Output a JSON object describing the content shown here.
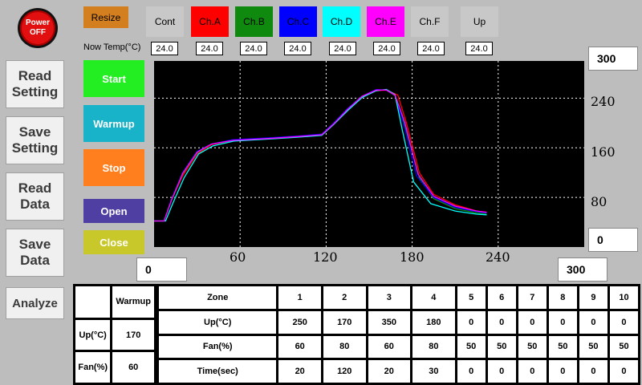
{
  "power": {
    "line1": "Power",
    "line2": "OFF"
  },
  "resize_label": "Resize",
  "channels": [
    {
      "label": "Cont",
      "color": "#c8c8c8",
      "temp": "24.0"
    },
    {
      "label": "Ch.A",
      "color": "#ff0000",
      "temp": "24.0"
    },
    {
      "label": "Ch.B",
      "color": "#0f8a0f",
      "temp": "24.0"
    },
    {
      "label": "Ch.C",
      "color": "#0000ff",
      "temp": "24.0"
    },
    {
      "label": "Ch.D",
      "color": "#00ffff",
      "temp": "24.0"
    },
    {
      "label": "Ch.E",
      "color": "#ff00ff",
      "temp": "24.0"
    },
    {
      "label": "Ch.F",
      "color": "#c8c8c8",
      "temp": "24.0"
    },
    {
      "label": "Up",
      "color": "#c8c8c8",
      "temp": "24.0"
    }
  ],
  "now_temp_label": "Now Temp(°C)",
  "sidebar": [
    "Read\nSetting",
    "Save\nSetting",
    "Read\nData",
    "Save\nData"
  ],
  "analyze_label": "Analyze",
  "controls": [
    {
      "label": "Start",
      "color": "#22ee22"
    },
    {
      "label": "Warmup",
      "color": "#18b2c9"
    },
    {
      "label": "Stop",
      "color": "#ff7f1f"
    },
    {
      "label": "Open",
      "color": "#4f3fa3"
    },
    {
      "label": "Close",
      "color": "#c8c82a"
    }
  ],
  "axis_inputs": {
    "y_max": "300",
    "y_min": "0",
    "x_min": "0",
    "x_max": "300"
  },
  "chart_data": {
    "type": "line",
    "xlim": [
      0,
      300
    ],
    "ylim": [
      0,
      300
    ],
    "x_ticks": [
      "60",
      "120",
      "180",
      "240"
    ],
    "y_ticks": [
      "240",
      "160",
      "80"
    ],
    "grid": true,
    "series": [
      {
        "color": "#ff0000",
        "points": [
          [
            0,
            42
          ],
          [
            7,
            42
          ],
          [
            12,
            75
          ],
          [
            20,
            115
          ],
          [
            30,
            150
          ],
          [
            40,
            165
          ],
          [
            55,
            172
          ],
          [
            80,
            175
          ],
          [
            100,
            178
          ],
          [
            117,
            182
          ],
          [
            125,
            198
          ],
          [
            135,
            222
          ],
          [
            145,
            242
          ],
          [
            155,
            252
          ],
          [
            162,
            253
          ],
          [
            170,
            245
          ],
          [
            176,
            200
          ],
          [
            185,
            120
          ],
          [
            195,
            85
          ],
          [
            210,
            68
          ],
          [
            225,
            58
          ],
          [
            232,
            56
          ]
        ]
      },
      {
        "color": "#0f8a0f",
        "points": [
          [
            0,
            42
          ],
          [
            7,
            42
          ],
          [
            12,
            74
          ],
          [
            20,
            118
          ],
          [
            30,
            152
          ],
          [
            40,
            166
          ],
          [
            55,
            172
          ],
          [
            80,
            175
          ],
          [
            100,
            178
          ],
          [
            117,
            182
          ],
          [
            125,
            199
          ],
          [
            135,
            222
          ],
          [
            145,
            243
          ],
          [
            155,
            253
          ],
          [
            162,
            253
          ],
          [
            168,
            244
          ],
          [
            175,
            195
          ],
          [
            185,
            112
          ],
          [
            195,
            78
          ],
          [
            210,
            62
          ],
          [
            225,
            55
          ],
          [
            232,
            53
          ]
        ]
      },
      {
        "color": "#0000ff",
        "points": [
          [
            0,
            42
          ],
          [
            7,
            42
          ],
          [
            12,
            76
          ],
          [
            20,
            120
          ],
          [
            30,
            154
          ],
          [
            40,
            166
          ],
          [
            55,
            173
          ],
          [
            80,
            176
          ],
          [
            100,
            179
          ],
          [
            117,
            182
          ],
          [
            125,
            199
          ],
          [
            135,
            223
          ],
          [
            145,
            243
          ],
          [
            155,
            254
          ],
          [
            162,
            253
          ],
          [
            168,
            245
          ],
          [
            174,
            198
          ],
          [
            183,
            115
          ],
          [
            195,
            80
          ],
          [
            210,
            64
          ],
          [
            225,
            57
          ],
          [
            232,
            55
          ]
        ]
      },
      {
        "color": "#00ffff",
        "points": [
          [
            0,
            42
          ],
          [
            8,
            42
          ],
          [
            13,
            70
          ],
          [
            21,
            112
          ],
          [
            31,
            150
          ],
          [
            41,
            163
          ],
          [
            56,
            171
          ],
          [
            80,
            174
          ],
          [
            100,
            177
          ],
          [
            117,
            180
          ],
          [
            125,
            197
          ],
          [
            135,
            220
          ],
          [
            145,
            241
          ],
          [
            155,
            252
          ],
          [
            162,
            254
          ],
          [
            168,
            246
          ],
          [
            173,
            190
          ],
          [
            181,
            105
          ],
          [
            193,
            70
          ],
          [
            210,
            58
          ],
          [
            225,
            53
          ],
          [
            232,
            52
          ]
        ]
      },
      {
        "color": "#ff00ff",
        "points": [
          [
            0,
            42
          ],
          [
            7,
            42
          ],
          [
            12,
            75
          ],
          [
            20,
            119
          ],
          [
            30,
            153
          ],
          [
            40,
            166
          ],
          [
            55,
            172
          ],
          [
            80,
            175
          ],
          [
            100,
            178
          ],
          [
            117,
            181
          ],
          [
            125,
            198
          ],
          [
            135,
            222
          ],
          [
            145,
            243
          ],
          [
            155,
            253
          ],
          [
            162,
            253
          ],
          [
            168,
            245
          ],
          [
            175,
            200
          ],
          [
            184,
            118
          ],
          [
            195,
            82
          ],
          [
            210,
            66
          ],
          [
            225,
            58
          ],
          [
            232,
            56
          ]
        ]
      }
    ]
  },
  "param_table": {
    "header": [
      "",
      "Warmup"
    ],
    "rows": [
      [
        "Up(°C)",
        "170"
      ],
      [
        "Fan(%)",
        "60"
      ]
    ]
  },
  "zone_table": {
    "header": [
      "Zone",
      "1",
      "2",
      "3",
      "4",
      "5",
      "6",
      "7",
      "8",
      "9",
      "10"
    ],
    "rows": [
      [
        "Up(°C)",
        "250",
        "170",
        "350",
        "180",
        "0",
        "0",
        "0",
        "0",
        "0",
        "0"
      ],
      [
        "Fan(%)",
        "60",
        "80",
        "60",
        "80",
        "50",
        "50",
        "50",
        "50",
        "50",
        "50"
      ],
      [
        "Time(sec)",
        "20",
        "120",
        "20",
        "30",
        "0",
        "0",
        "0",
        "0",
        "0",
        "0"
      ]
    ]
  }
}
